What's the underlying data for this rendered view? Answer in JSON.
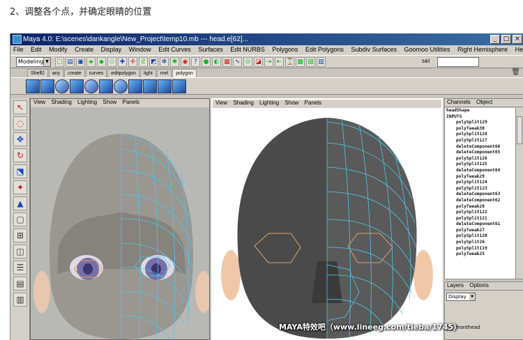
{
  "caption": "2、调整各个点，并确定眼睛的位置",
  "window": {
    "title": "Maya 4.0: E:\\scenes\\dankangle\\New_Project\\temp10.mb  ---  head.e[62]...",
    "minimize": "_",
    "maximize": "□",
    "close": "×"
  },
  "menu": [
    "File",
    "Edit",
    "Modify",
    "Create",
    "Display",
    "Window",
    "Edit Curves",
    "Surfaces",
    "Edit NURBS",
    "Polygons",
    "Edit Polygons",
    "Subdiv Surfaces",
    "Goomoo Utilities",
    "Right Hemisphere",
    "Help"
  ],
  "status_line": {
    "mode": "Modeling",
    "sel_label": "sel"
  },
  "shelf_tabs": [
    "Shelf2",
    "any",
    "create",
    "curves",
    "editpolygon",
    "light",
    "mel",
    "polygon"
  ],
  "panels": {
    "left_menu": [
      "View",
      "Shading",
      "Lighting",
      "Show",
      "Panels"
    ],
    "right_menu": [
      "View",
      "Shading",
      "Lighting",
      "Show",
      "Panels"
    ]
  },
  "channel_box": {
    "tabs": [
      "Channels",
      "Object"
    ],
    "node": "headShape",
    "inputs_label": "INPUTS",
    "inputs": [
      "polySplit129",
      "polyTweak30",
      "polySplit128",
      "polySplit127",
      "deleteComponent66",
      "deleteComponent65",
      "polySplit126",
      "polySplit125",
      "deleteComponent64",
      "polyTweak29",
      "polySplit124",
      "polySplit123",
      "deleteComponent63",
      "deleteComponent62",
      "polyTweak28",
      "polySplit122",
      "polySplit121",
      "deleteComponent61",
      "polyTweak27",
      "polySplit120",
      "polySplit26",
      "polySplit119",
      "polyTweak25"
    ]
  },
  "layers": {
    "tabs": [
      "Layers",
      "Options"
    ],
    "display": "Display",
    "layer_visible": "V",
    "layer_name": "fronthead"
  },
  "watermark": "MAYA特效吧（www.lineeg.com/tieba/1745）",
  "colors": {
    "title_start": "#0a246a",
    "title_end": "#3a6ea5",
    "wire": "#4ec8ee",
    "eye_loop": "#e0a060",
    "head_shade": "#4a4a4a"
  }
}
